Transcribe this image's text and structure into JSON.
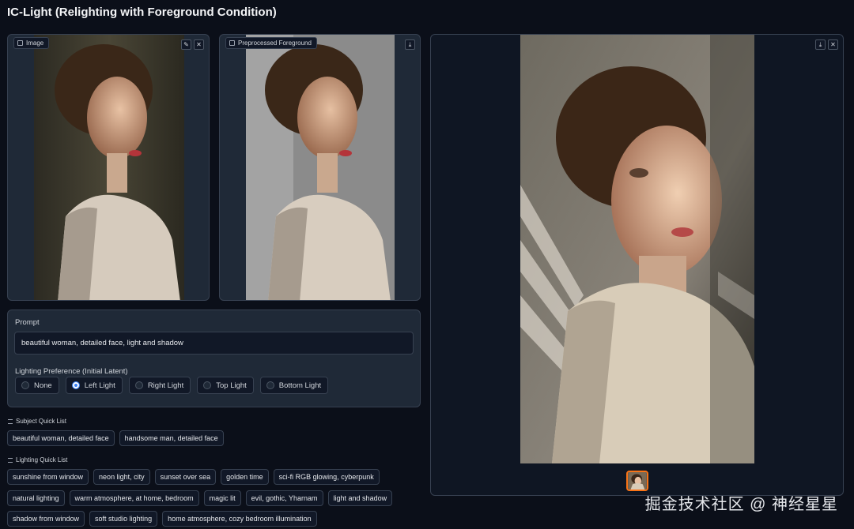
{
  "app": {
    "title": "IC-Light (Relighting with Foreground Condition)"
  },
  "image_panel": {
    "label": "Image",
    "edit_icon": "pencil-icon",
    "close_icon": "close-icon"
  },
  "preprocessed_panel": {
    "label": "Preprocessed Foreground",
    "download_icon": "download-icon"
  },
  "output_panel": {
    "download_icon": "download-icon",
    "close_icon": "close-icon"
  },
  "prompt": {
    "label": "Prompt",
    "value": "beautiful woman, detailed face, light and shadow"
  },
  "lighting": {
    "label": "Lighting Preference (Initial Latent)",
    "options": [
      "None",
      "Left Light",
      "Right Light",
      "Top Light",
      "Bottom Light"
    ],
    "selected": "Left Light"
  },
  "subject_quick_list": {
    "label": "Subject Quick List",
    "items": [
      "beautiful woman, detailed face",
      "handsome man, detailed face"
    ]
  },
  "lighting_quick_list": {
    "label": "Lighting Quick List",
    "rows": [
      [
        "sunshine from window",
        "neon light, city",
        "sunset over sea",
        "golden time",
        "sci-fi RGB glowing, cyberpunk"
      ],
      [
        "natural lighting",
        "warm atmosphere, at home, bedroom",
        "magic lit",
        "evil, gothic, Yharnam",
        "light and shadow"
      ],
      [
        "shadow from window",
        "soft studio lighting",
        "home atmosphere, cozy bedroom illumination"
      ]
    ]
  },
  "watermark": "掘金技术社区 @ 神经星星",
  "colors": {
    "accent": "#3b82f6",
    "thumb_border": "#f97316",
    "background": "#0b0f19"
  }
}
